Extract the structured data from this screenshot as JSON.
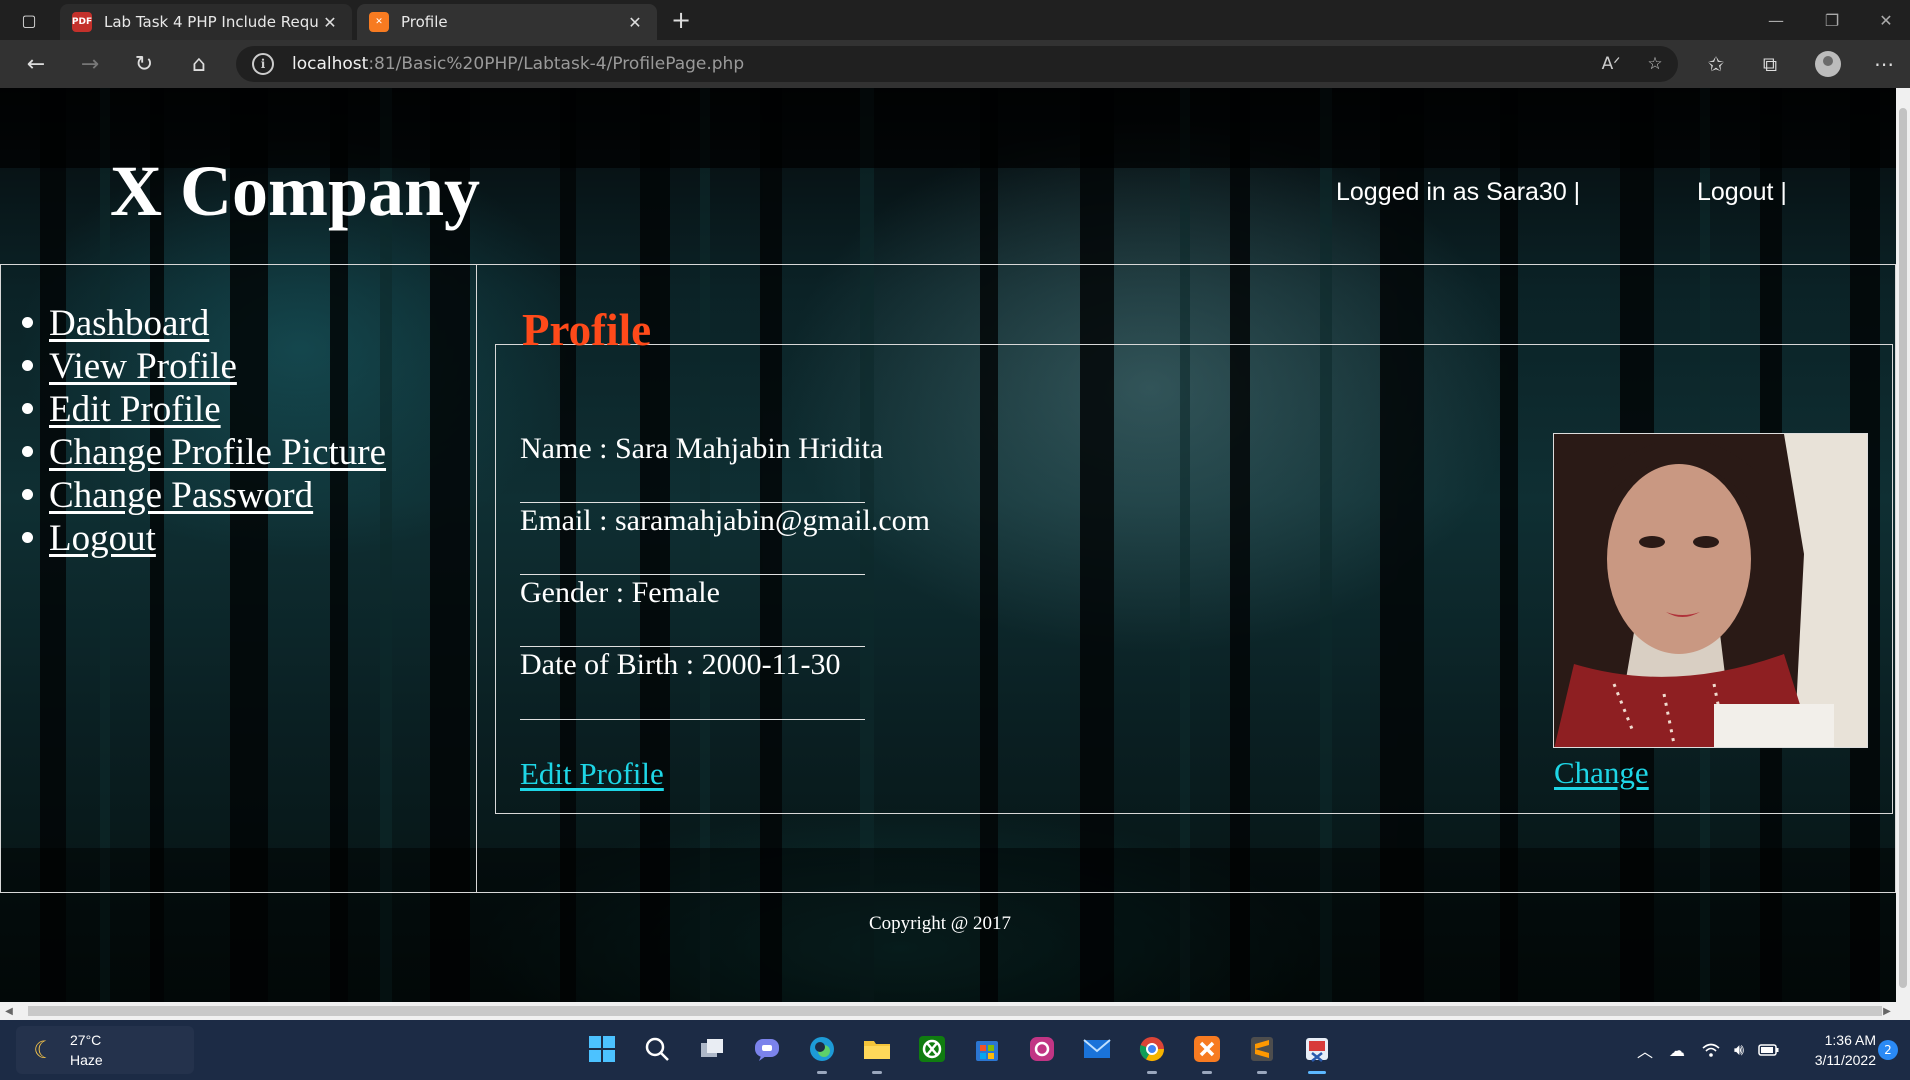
{
  "browser": {
    "tabs": [
      {
        "title": "Lab Task 4 PHP Include Require",
        "favicon": "pdf-icon",
        "favicon_text": "PDF"
      },
      {
        "title": "Profile",
        "favicon": "xampp-icon",
        "favicon_text": "✕"
      }
    ],
    "address": {
      "host": "localhost",
      "rest": ":81/Basic%20PHP/Labtask-4/ProfilePage.php"
    }
  },
  "site": {
    "title": "X Company",
    "logged_in_text": "Logged in as Sara30 |",
    "logout_header": "Logout |"
  },
  "sidebar": {
    "items": [
      {
        "label": "Dashboard"
      },
      {
        "label": "View Profile"
      },
      {
        "label": "Edit Profile"
      },
      {
        "label": "Change Profile Picture"
      },
      {
        "label": "Change Password"
      },
      {
        "label": "Logout"
      }
    ]
  },
  "profile": {
    "legend": "Profile",
    "name": "Name : Sara Mahjabin Hridita",
    "email": "Email : saramahjabin@gmail.com",
    "gender": "Gender : Female",
    "dob": "Date of Birth : 2000-11-30",
    "edit_link": "Edit Profile",
    "change_link": "Change"
  },
  "footer": {
    "text": "Copyright @ 2017"
  },
  "taskbar": {
    "weather_temp": "27°C",
    "weather_desc": "Haze",
    "time": "1:36 AM",
    "date": "3/11/2022",
    "notifications": "2"
  },
  "colors": {
    "legend": "#ff4a1a",
    "link": "#1ed6e6",
    "taskbar": "#1c2b45"
  }
}
